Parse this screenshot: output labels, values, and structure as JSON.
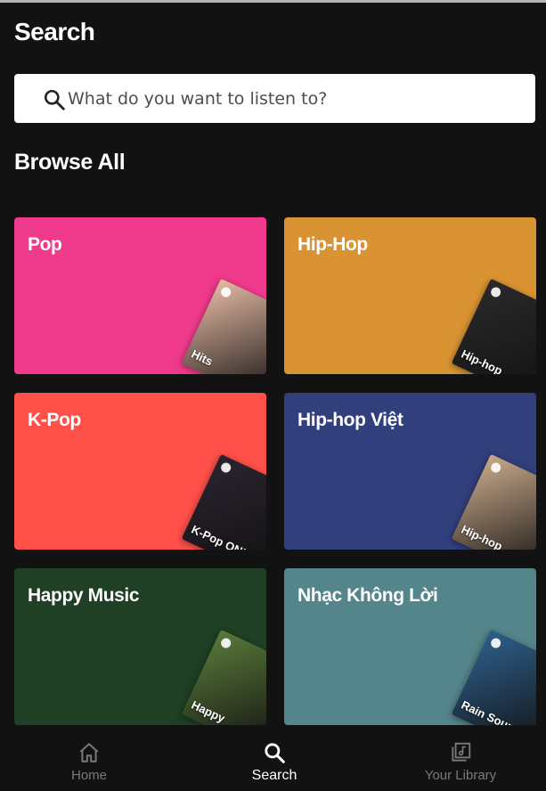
{
  "header": {
    "title": "Search"
  },
  "search": {
    "placeholder": "What do you want to listen to?"
  },
  "browse": {
    "title": "Browse All",
    "tiles": [
      {
        "label": "Pop",
        "color": "#f03a8c",
        "art_text": "Hits",
        "art_color": "#e5b9a3"
      },
      {
        "label": "Hip-Hop",
        "color": "#d99332",
        "art_text": "Hip-hop",
        "art_color": "#2a2a2a"
      },
      {
        "label": "K-Pop",
        "color": "#ff5049",
        "art_text": "K-Pop ON!",
        "art_color": "#2b2430"
      },
      {
        "label": "Hip-hop Việt",
        "color": "#313f7d",
        "art_text": "Hip-hop",
        "art_color": "#c9a98a"
      },
      {
        "label": "Happy Music",
        "color": "#1f4024",
        "art_text": "Happy",
        "art_color": "#5a7a3a"
      },
      {
        "label": "Nhạc Không Lời",
        "color": "#53858b",
        "art_text": "Rain Sounds",
        "art_color": "#2e5f8c"
      }
    ]
  },
  "nav": {
    "items": [
      {
        "label": "Home",
        "icon": "home-icon",
        "active": false
      },
      {
        "label": "Search",
        "icon": "search-icon",
        "active": true
      },
      {
        "label": "Your Library",
        "icon": "library-icon",
        "active": false
      }
    ]
  }
}
